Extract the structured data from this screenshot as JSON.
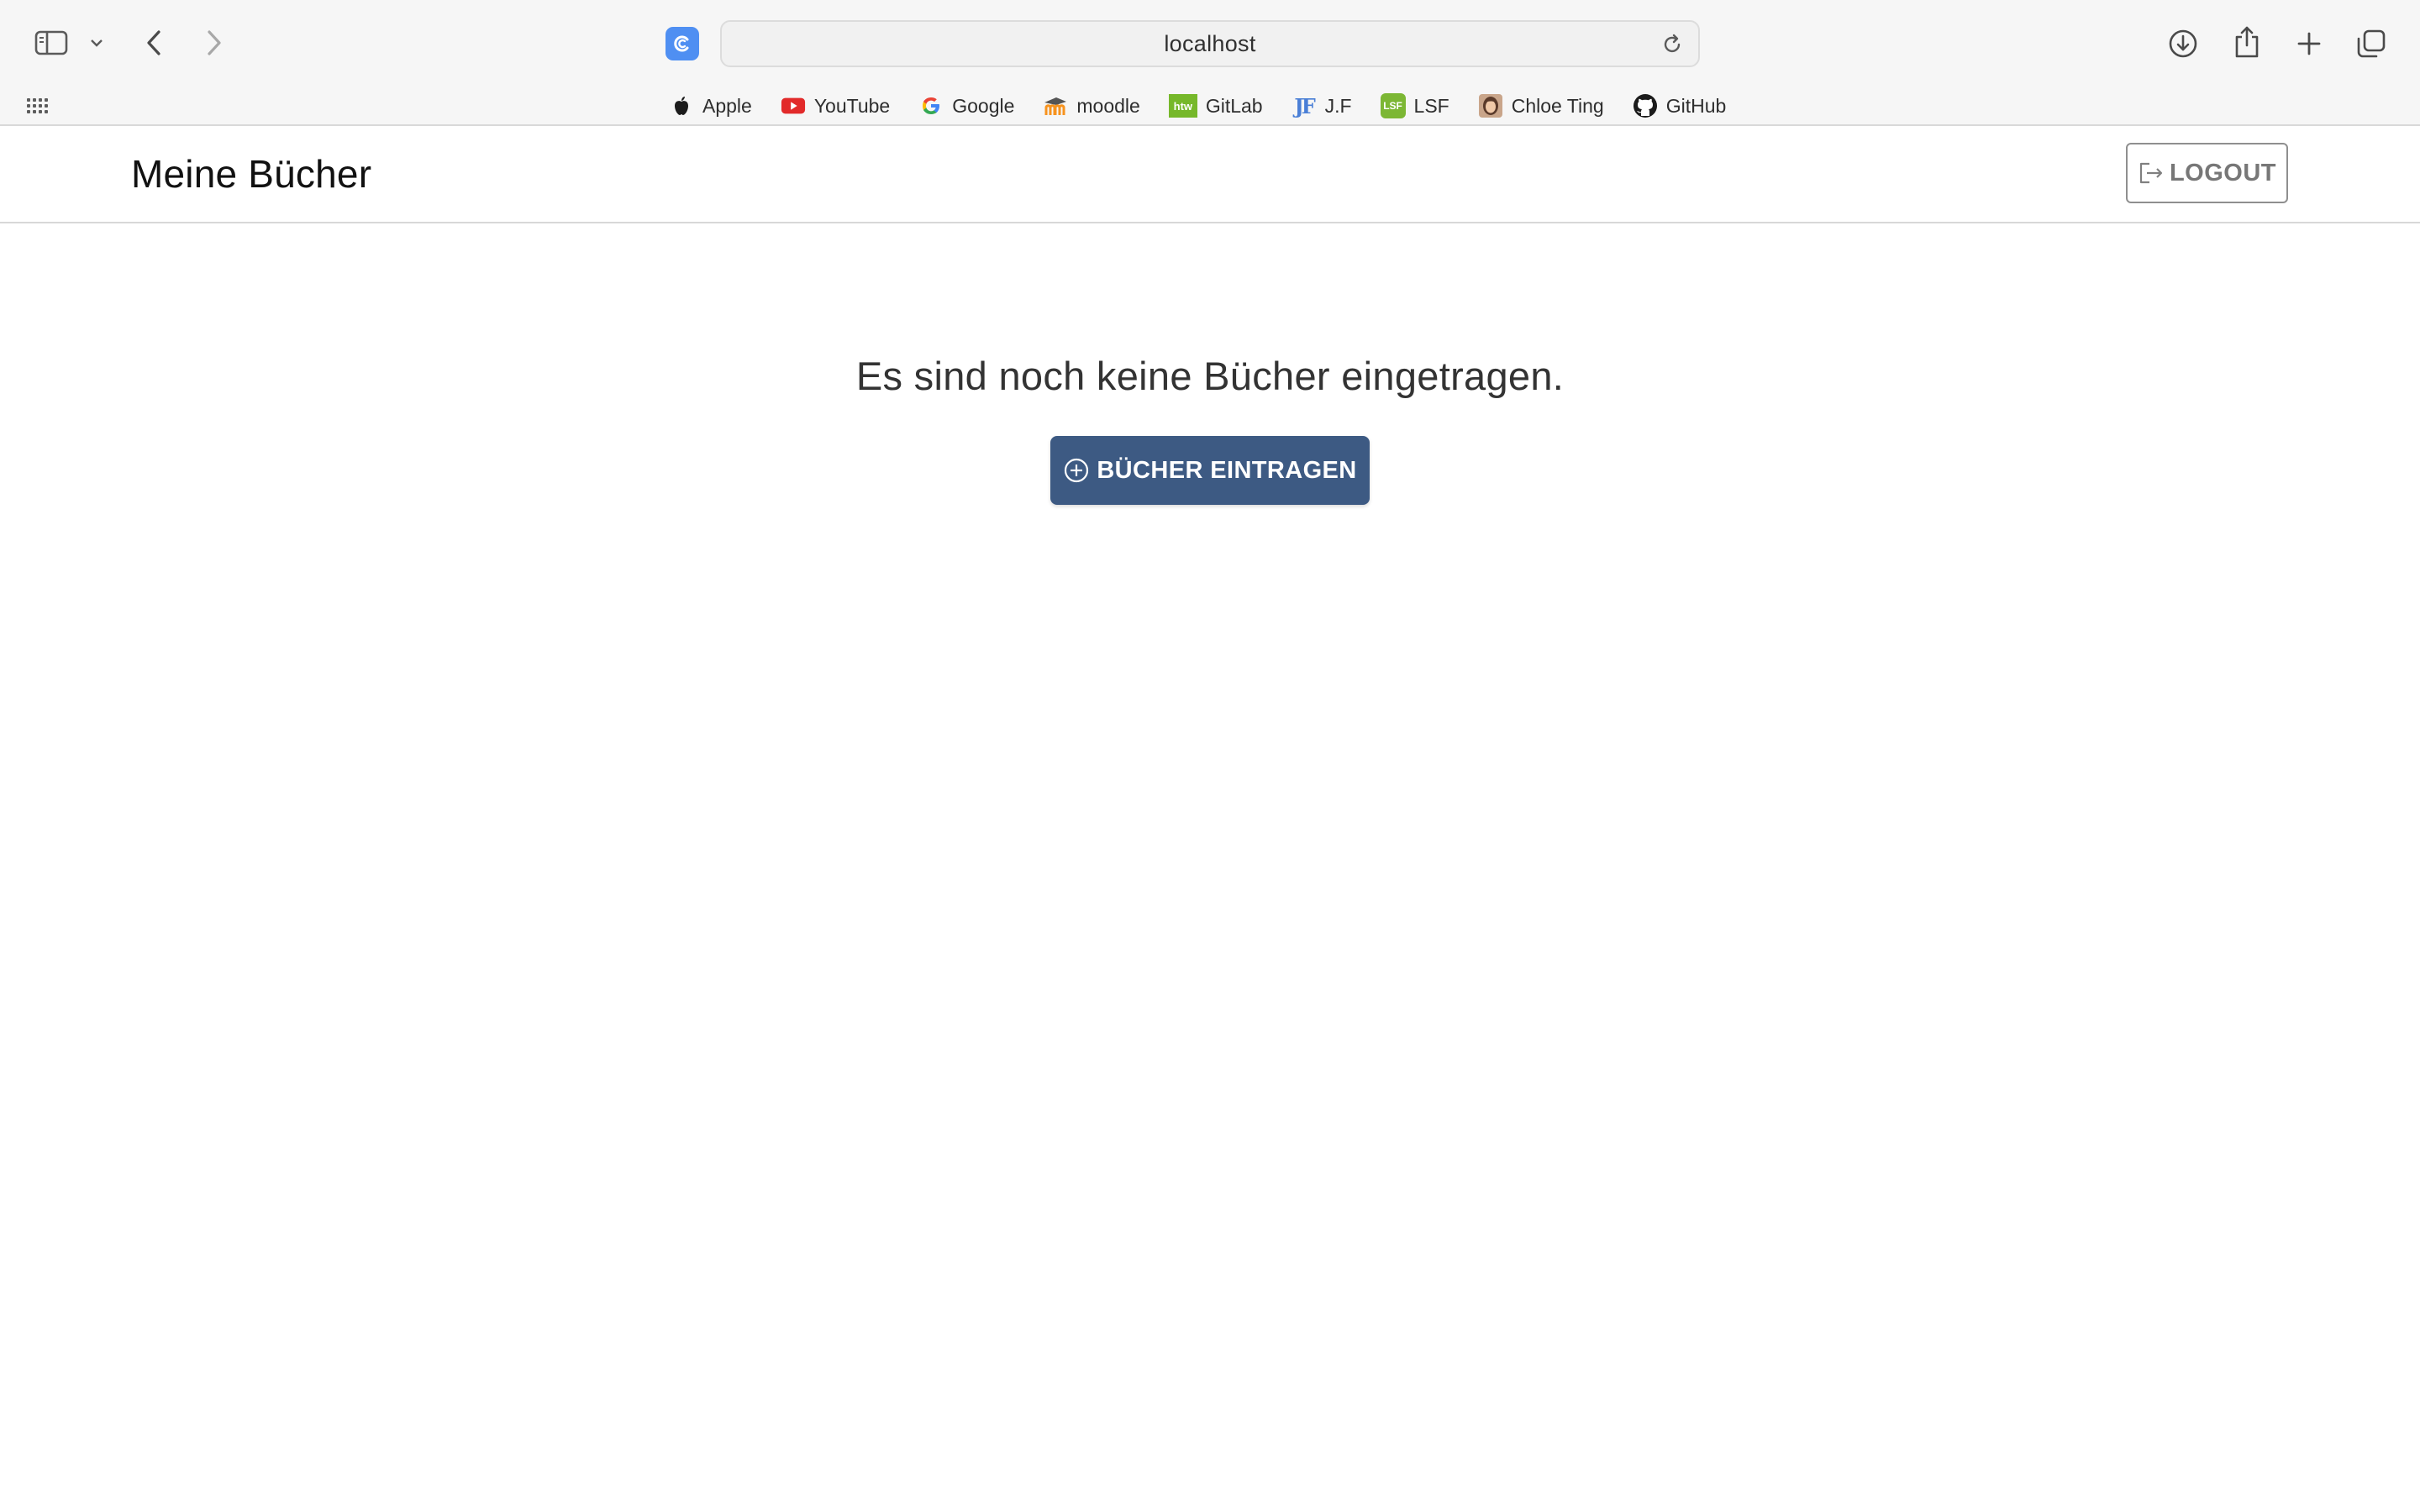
{
  "browser": {
    "address": "localhost",
    "bookmarks": [
      {
        "label": "Apple",
        "icon": "apple-icon"
      },
      {
        "label": "YouTube",
        "icon": "youtube-icon"
      },
      {
        "label": "Google",
        "icon": "google-icon"
      },
      {
        "label": "moodle",
        "icon": "moodle-icon"
      },
      {
        "label": "GitLab",
        "icon": "htw-icon",
        "icon_text": "htw"
      },
      {
        "label": "J.F",
        "icon": "jf-icon",
        "icon_text": "JF"
      },
      {
        "label": "LSF",
        "icon": "lsf-icon",
        "icon_text": "LSF"
      },
      {
        "label": "Chloe Ting",
        "icon": "chloe-ting-avatar-icon"
      },
      {
        "label": "GitHub",
        "icon": "github-icon"
      }
    ]
  },
  "app": {
    "title": "Meine Bücher",
    "logout_label": "LOGOUT",
    "empty_message": "Es sind noch keine Bücher eingetragen.",
    "add_books_label": "BÜCHER EINTRAGEN"
  },
  "colors": {
    "primary_button": "#3d5a83",
    "chrome_background": "#f6f6f6"
  }
}
